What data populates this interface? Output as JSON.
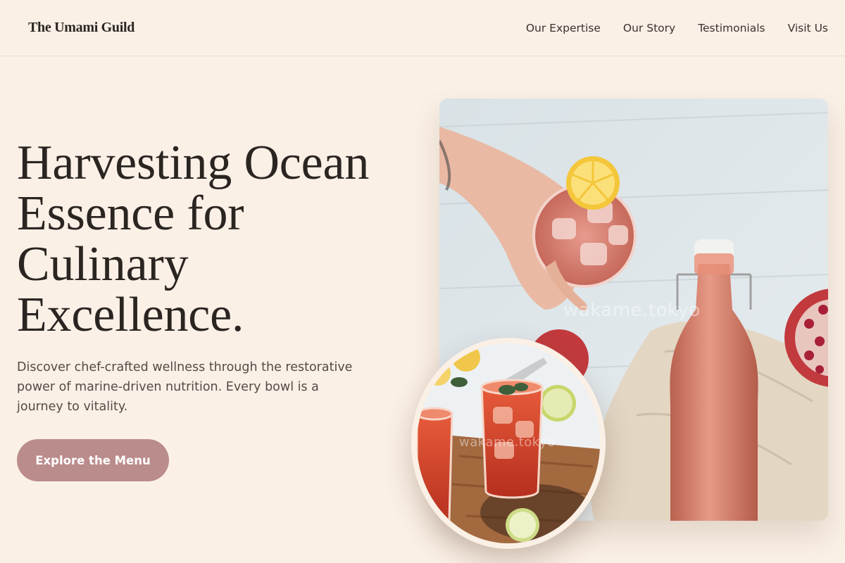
{
  "header": {
    "logo": "The Umami Guild",
    "nav": [
      "Our Expertise",
      "Our Story",
      "Testimonials",
      "Visit Us"
    ]
  },
  "hero": {
    "title": "Harvesting Ocean Essence for Culinary Excellence.",
    "subtitle": "Discover chef-crafted wellness through the restorative power of marine-driven nutrition. Every bowl is a journey to vitality.",
    "cta": "Explore the Menu"
  },
  "images": {
    "main_watermark": "wakame.tokyo",
    "inset_watermark": "wakame.tokyo"
  },
  "colors": {
    "background": "#faf0e6",
    "button": "#bb8c8c",
    "text": "#2b2522"
  }
}
